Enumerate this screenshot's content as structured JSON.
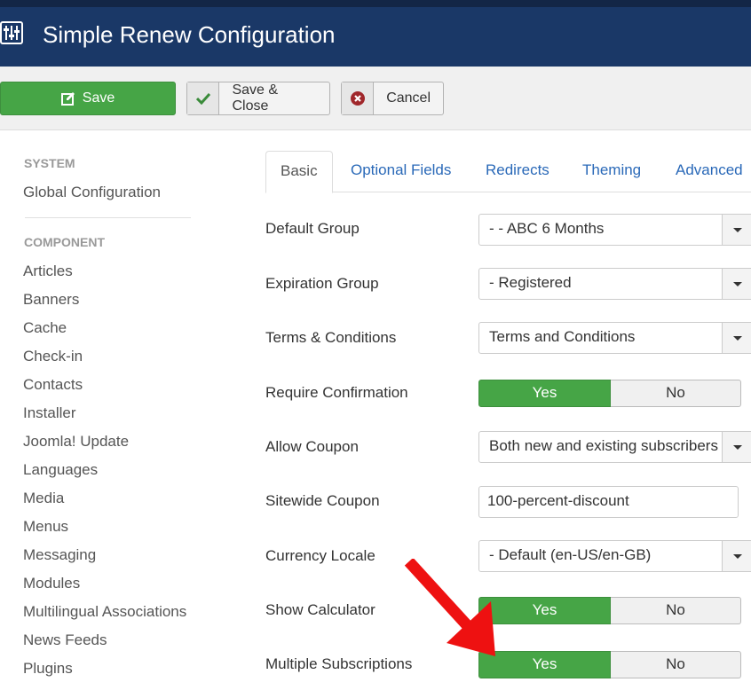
{
  "header": {
    "title": "Simple Renew Configuration",
    "icon": "options-sliders-icon"
  },
  "toolbar": {
    "save_label": "Save",
    "save_icon": "edit-icon",
    "save_close_label": "Save & Close",
    "save_close_icon": "checkmark-icon",
    "cancel_label": "Cancel",
    "cancel_icon": "cancel-circle-icon"
  },
  "sidebar": {
    "system_heading": "SYSTEM",
    "system_items": [
      {
        "label": "Global Configuration"
      }
    ],
    "component_heading": "COMPONENT",
    "component_items": [
      {
        "label": "Articles"
      },
      {
        "label": "Banners"
      },
      {
        "label": "Cache"
      },
      {
        "label": "Check-in"
      },
      {
        "label": "Contacts"
      },
      {
        "label": "Installer"
      },
      {
        "label": "Joomla! Update"
      },
      {
        "label": "Languages"
      },
      {
        "label": "Media"
      },
      {
        "label": "Menus"
      },
      {
        "label": "Messaging"
      },
      {
        "label": "Modules"
      },
      {
        "label": "Multilingual Associations"
      },
      {
        "label": "News Feeds"
      },
      {
        "label": "Plugins"
      }
    ]
  },
  "tabs": [
    {
      "label": "Basic",
      "active": true
    },
    {
      "label": "Optional Fields",
      "active": false
    },
    {
      "label": "Redirects",
      "active": false
    },
    {
      "label": "Theming",
      "active": false
    },
    {
      "label": "Advanced",
      "active": false
    }
  ],
  "form": {
    "default_group": {
      "label": "Default Group",
      "value": "- - ABC 6 Months"
    },
    "expiration_group": {
      "label": "Expiration Group",
      "value": "- Registered"
    },
    "terms": {
      "label": "Terms & Conditions",
      "value": "Terms and Conditions"
    },
    "require_confirmation": {
      "label": "Require Confirmation",
      "yes": "Yes",
      "no": "No",
      "selected": "Yes"
    },
    "allow_coupon": {
      "label": "Allow Coupon",
      "value": "Both new and existing subscribers"
    },
    "sitewide_coupon": {
      "label": "Sitewide Coupon",
      "value": "100-percent-discount"
    },
    "currency_locale": {
      "label": "Currency Locale",
      "value": "- Default (en-US/en-GB)"
    },
    "show_calculator": {
      "label": "Show Calculator",
      "yes": "Yes",
      "no": "No",
      "selected": "Yes"
    },
    "multiple_subscriptions": {
      "label": "Multiple Subscriptions",
      "yes": "Yes",
      "no": "No",
      "selected": "Yes"
    }
  },
  "annotation": {
    "icon": "red-arrow-icon",
    "color": "#ee1111"
  },
  "colors": {
    "header_bg": "#1a3867",
    "success": "#46a546",
    "link": "#2a69b8",
    "danger": "#a0272b"
  }
}
